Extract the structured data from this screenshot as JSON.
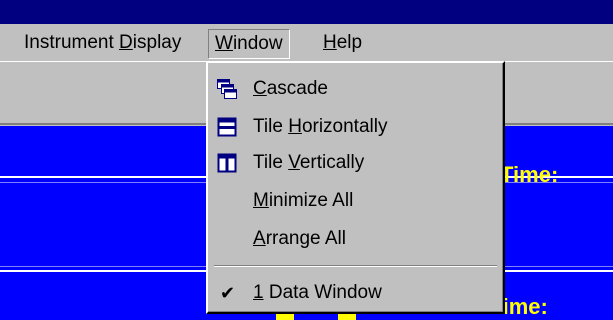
{
  "menubar": {
    "instrument_display": {
      "pre": "Instrument ",
      "u": "D",
      "post": "isplay"
    },
    "window": {
      "pre": "",
      "u": "W",
      "post": "indow"
    },
    "help": {
      "pre": "",
      "u": "H",
      "post": "elp"
    }
  },
  "window_menu": {
    "cascade": {
      "pre": "",
      "u": "C",
      "post": "ascade",
      "icon": "cascade-icon"
    },
    "tile_horizontally": {
      "pre": "Tile ",
      "u": "H",
      "post": "orizontally",
      "icon": "tile-horizontal-icon"
    },
    "tile_vertically": {
      "pre": "Tile ",
      "u": "V",
      "post": "ertically",
      "icon": "tile-vertical-icon"
    },
    "minimize_all": {
      "pre": "",
      "u": "M",
      "post": "inimize All"
    },
    "arrange_all": {
      "pre": "",
      "u": "A",
      "post": "rrange All"
    },
    "data_window": {
      "check": "✔",
      "pre": "",
      "u": "1",
      "post": " Data Window"
    }
  },
  "mdi": {
    "label_top": "Time:",
    "label_bottom": "d Time:"
  },
  "colors": {
    "titlebar": "#000080",
    "workspace": "#0000ff",
    "label": "#ffff00",
    "menu_face": "#c0c0c0"
  }
}
